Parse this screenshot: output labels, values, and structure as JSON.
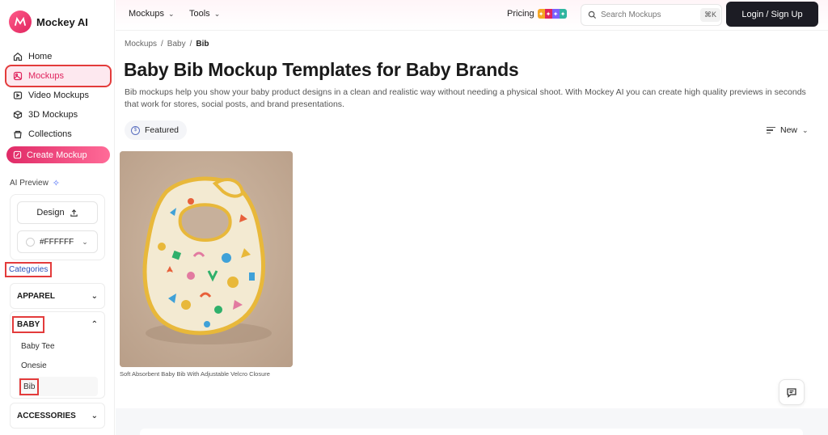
{
  "brand": {
    "name": "Mockey AI",
    "accent": "#e0245e"
  },
  "sidebar": {
    "nav": [
      {
        "label": "Home",
        "icon": "home-icon",
        "active": false
      },
      {
        "label": "Mockups",
        "icon": "mockups-icon",
        "active": true
      },
      {
        "label": "Video Mockups",
        "icon": "video-icon",
        "active": false
      },
      {
        "label": "3D Mockups",
        "icon": "cube-icon",
        "active": false
      },
      {
        "label": "Collections",
        "icon": "collections-icon",
        "active": false
      }
    ],
    "create_label": "Create Mockup",
    "ai_preview_label": "AI Preview",
    "design_label": "Design",
    "color_value": "#FFFFFF",
    "categories_label": "Categories",
    "categories": {
      "apparel": "APPAREL",
      "baby": "BABY",
      "baby_items": [
        "Baby Tee",
        "Onesie",
        "Bib"
      ],
      "accessories": "ACCESSORIES"
    }
  },
  "topbar": {
    "menu_mockups": "Mockups",
    "menu_tools": "Tools",
    "pricing": "Pricing",
    "search_placeholder": "Search Mockups",
    "search_shortcut": "⌘K",
    "login": "Login / Sign Up"
  },
  "main": {
    "breadcrumb": [
      "Mockups",
      "Baby",
      "Bib"
    ],
    "title": "Baby Bib Mockup Templates for Baby Brands",
    "description": "Bib mockups help you show your baby product designs in a clean and realistic way without needing a physical shoot. With Mockey AI you can create high quality previews in seconds that work for stores, social posts, and brand presentations.",
    "featured_label": "Featured",
    "sort_label": "New",
    "cards": [
      {
        "caption": "Soft Absorbent Baby Bib With Adjustable Velcro Closure"
      }
    ]
  }
}
